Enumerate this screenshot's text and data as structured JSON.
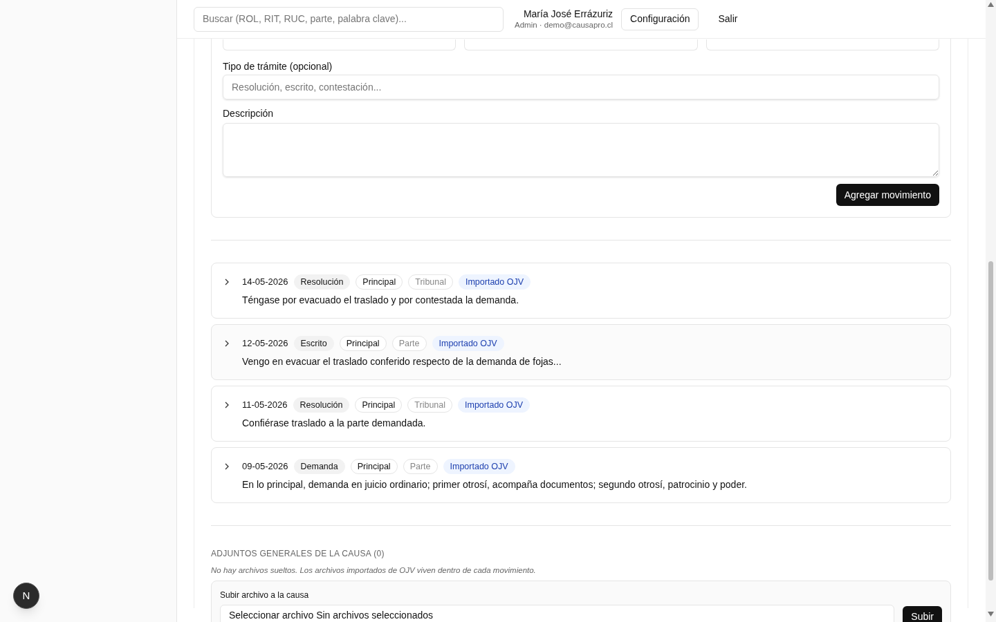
{
  "header": {
    "search_placeholder": "Buscar (ROL, RIT, RUC, parte, palabra clave)...",
    "user_name": "María José Errázuriz",
    "user_detail": "Admin · demo@causapro.cl",
    "buttons": [
      "Configuración",
      "Salir"
    ]
  },
  "form": {
    "tipo_label": "Tipo de trámite (opcional)",
    "tipo_placeholder": "Resolución, escrito, contestación...",
    "descripcion_label": "Descripción",
    "submit": "Agregar movimiento"
  },
  "movements": [
    {
      "date": "14-05-2026",
      "tags": [
        {
          "kind": "type",
          "label": "Resolución"
        },
        {
          "kind": "scope",
          "label": "Principal"
        },
        {
          "kind": "origin",
          "label": "Tribunal"
        },
        {
          "kind": "source",
          "label": "Importado OJV"
        }
      ],
      "text": "Téngase por evacuado el traslado y por contestada la demanda."
    },
    {
      "date": "12-05-2026",
      "tags": [
        {
          "kind": "type",
          "label": "Escrito"
        },
        {
          "kind": "scope",
          "label": "Principal"
        },
        {
          "kind": "origin",
          "label": "Parte"
        },
        {
          "kind": "source",
          "label": "Importado OJV"
        }
      ],
      "text": "Vengo en evacuar el traslado conferido respecto de la demanda de fojas..."
    },
    {
      "date": "11-05-2026",
      "tags": [
        {
          "kind": "type",
          "label": "Resolución"
        },
        {
          "kind": "scope",
          "label": "Principal"
        },
        {
          "kind": "origin",
          "label": "Tribunal"
        },
        {
          "kind": "source",
          "label": "Importado OJV"
        }
      ],
      "text": "Confiérase traslado a la parte demandada."
    },
    {
      "date": "09-05-2026",
      "tags": [
        {
          "kind": "type",
          "label": "Demanda"
        },
        {
          "kind": "scope",
          "label": "Principal"
        },
        {
          "kind": "origin",
          "label": "Parte"
        },
        {
          "kind": "source",
          "label": "Importado OJV"
        }
      ],
      "text": "En lo principal, demanda en juicio ordinario; primer otrosí, acompaña documentos; segundo otrosí, patrocinio y poder."
    }
  ],
  "attachments": {
    "heading": "ADJUNTOS GENERALES DE LA CAUSA (0)",
    "note": "No hay archivos sueltos. Los archivos importados de OJV viven dentro de cada movimiento.",
    "upload_label": "Subir archivo a la causa",
    "file_button": "Seleccionar archivo",
    "file_status": "Sin archivos seleccionados",
    "submit": "Subir"
  },
  "floating_badge": "N"
}
